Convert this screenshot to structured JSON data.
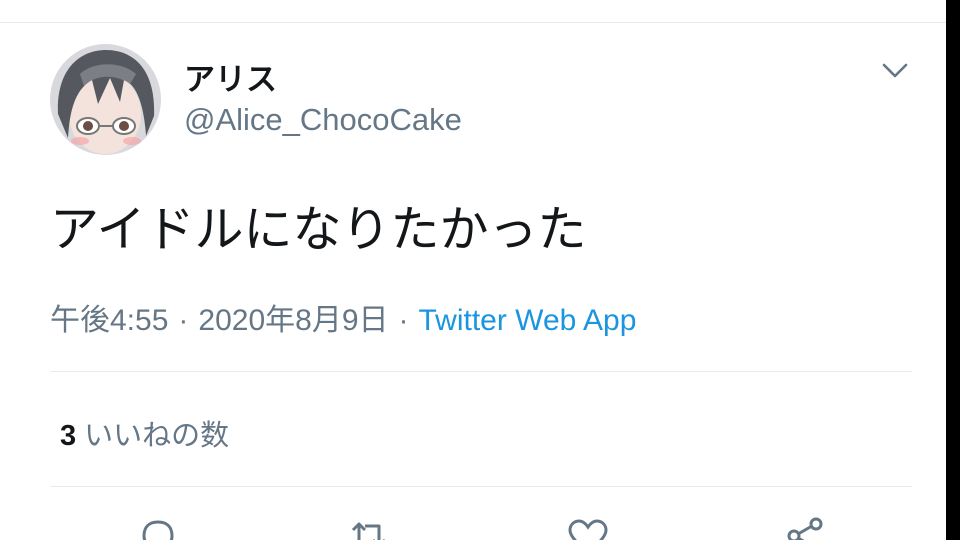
{
  "tweet": {
    "display_name": "アリス",
    "handle": "@Alice_ChocoCake",
    "text": "アイドルになりたかった",
    "time": "午後4:55",
    "date": "2020年8月9日",
    "separator": "·",
    "source": "Twitter Web App",
    "likes_count": "3",
    "likes_label": "いいねの数"
  },
  "icons": {
    "menu": "chevron-down-icon",
    "reply": "reply-icon",
    "retweet": "retweet-icon",
    "like": "heart-icon",
    "share": "share-icon"
  },
  "colors": {
    "text": "#14171a",
    "secondary": "#657786",
    "link": "#1b95e0",
    "divider": "#e6ecf0"
  }
}
